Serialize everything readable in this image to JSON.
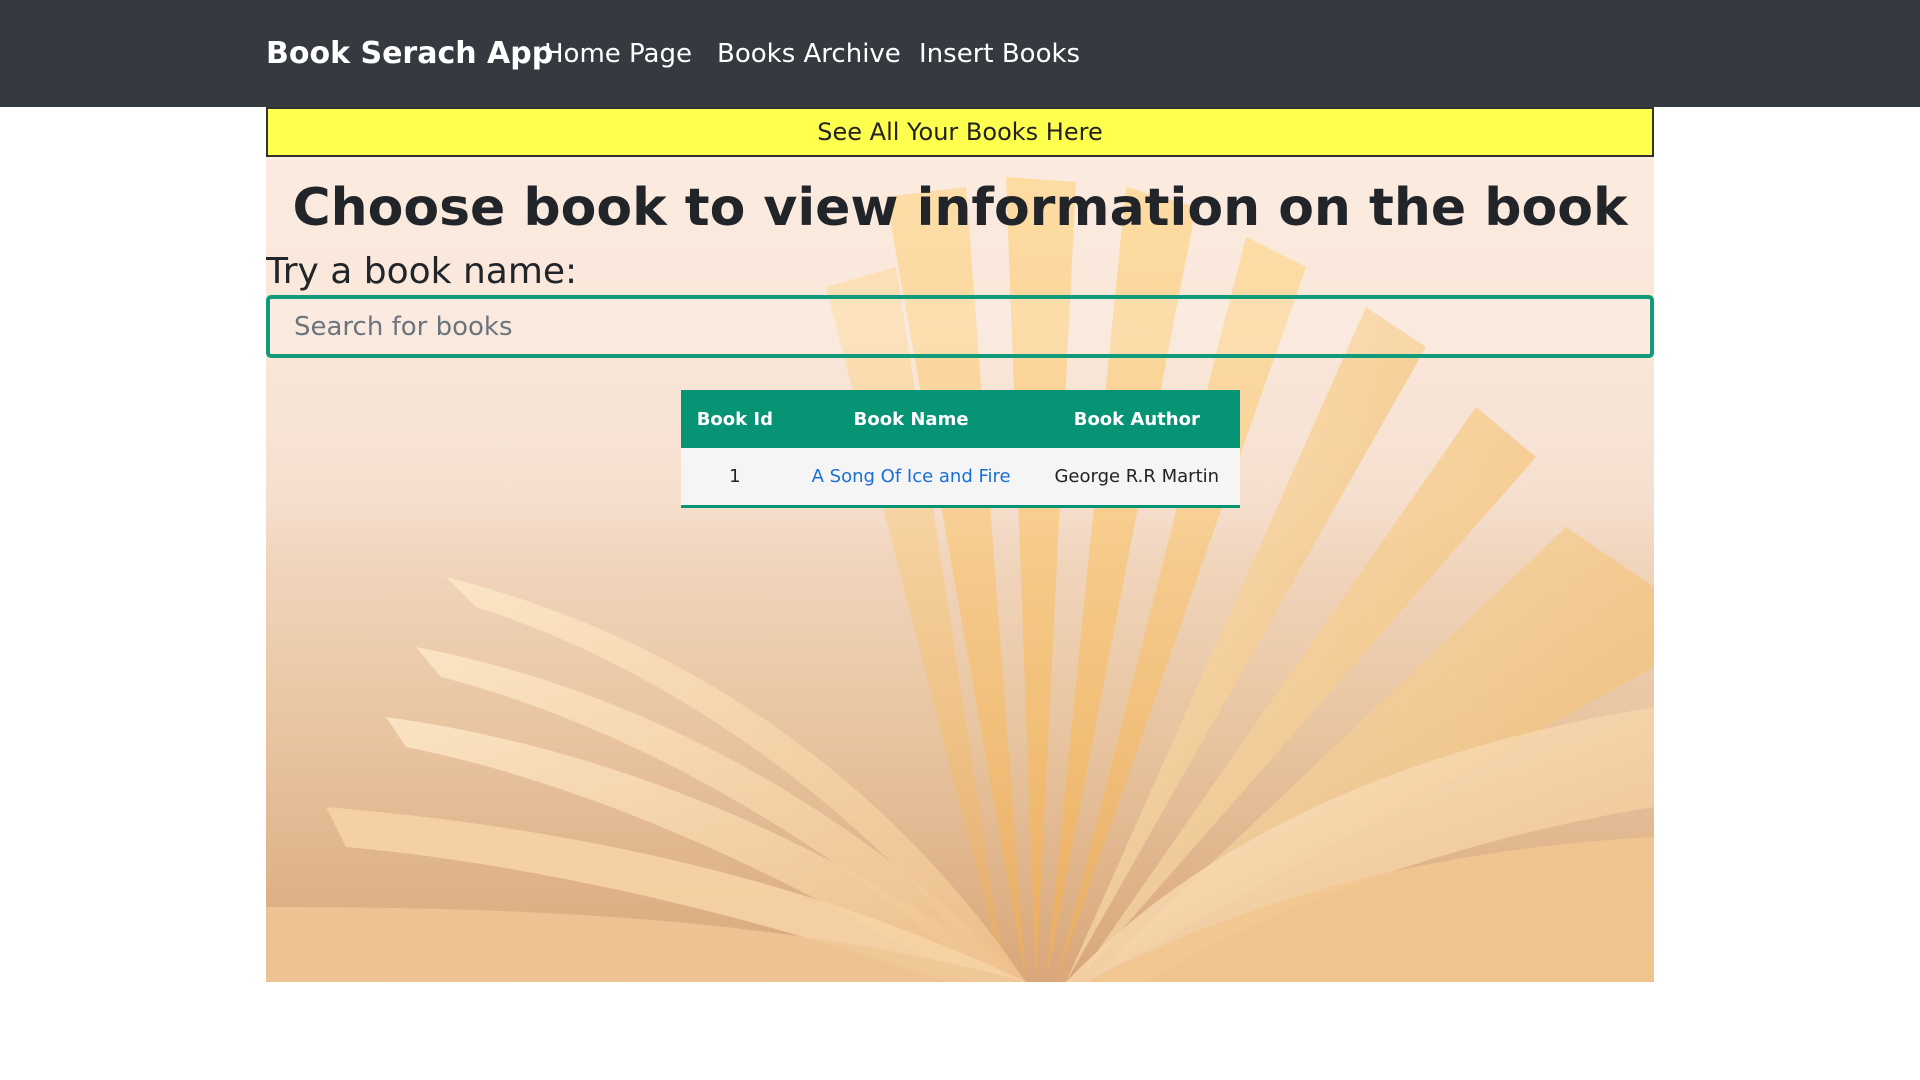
{
  "navbar": {
    "brand": "Book Serach App",
    "links": [
      "Home Page",
      "Books Archive",
      "Insert Books"
    ]
  },
  "banner": "See All Your Books Here",
  "headline": "Choose book to view information on the book",
  "search": {
    "label": "Try a book name:",
    "placeholder": "Search for books",
    "value": ""
  },
  "table": {
    "headers": [
      "Book Id",
      "Book Name",
      "Book Author"
    ],
    "rows": [
      {
        "id": "1",
        "name": "A Song Of Ice and Fire",
        "author": "George R.R Martin"
      }
    ]
  },
  "colors": {
    "navbar": "#343a40",
    "banner": "#ffff4d",
    "accent": "#079475",
    "link": "#1a6fd6"
  }
}
